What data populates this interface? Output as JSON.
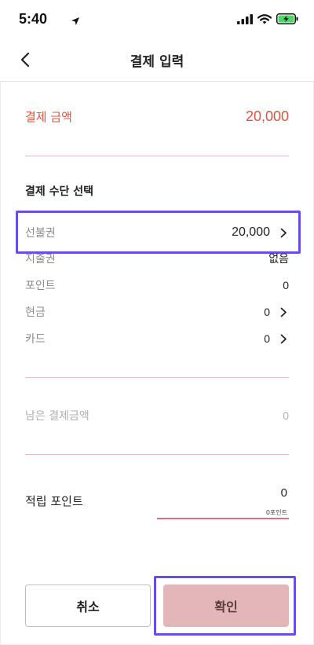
{
  "status_bar": {
    "time": "5:40"
  },
  "header": {
    "title": "결제 입력"
  },
  "payment_amount": {
    "label": "결제 금액",
    "value": "20,000"
  },
  "payment_methods": {
    "section_title": "결제 수단 선택",
    "items": [
      {
        "label": "선불권",
        "value": "20,000",
        "has_chevron": true,
        "selected": true
      },
      {
        "label": "지출권",
        "value": "없음",
        "has_chevron": false
      },
      {
        "label": "포인트",
        "value": "0",
        "has_chevron": false
      },
      {
        "label": "현금",
        "value": "0",
        "has_chevron": true
      },
      {
        "label": "카드",
        "value": "0",
        "has_chevron": true
      }
    ]
  },
  "remaining": {
    "label": "남은 결제금액",
    "value": "0"
  },
  "earn_points": {
    "label": "적립 포인트",
    "value": "0",
    "hint": "0포인트"
  },
  "buttons": {
    "cancel": "취소",
    "confirm": "확인"
  },
  "colors": {
    "accent_red": "#e0533f",
    "divider_pink": "#ecc0c8",
    "confirm_bg": "#e3b7b9",
    "highlight_purple": "#6a4de3"
  },
  "icons": {
    "back": "chevron-left-icon",
    "location": "location-arrow-icon",
    "signal": "signal-bars-icon",
    "wifi": "wifi-icon",
    "battery": "battery-charging-icon",
    "row_chevron": "chevron-right-icon"
  }
}
